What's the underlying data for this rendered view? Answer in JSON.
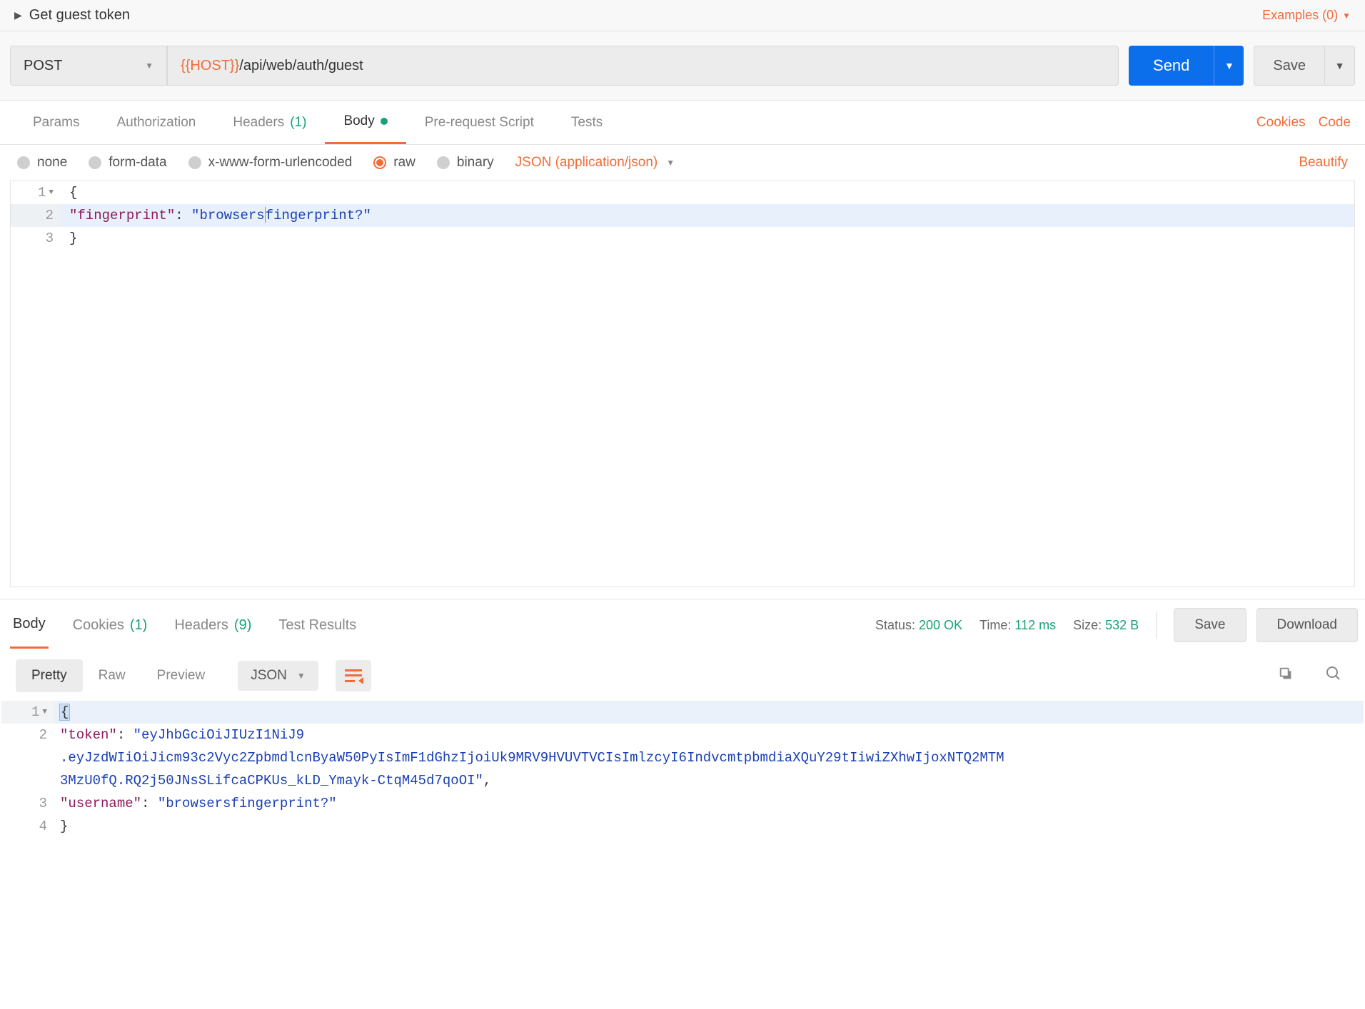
{
  "title": "Get guest token",
  "examples": {
    "label": "Examples (0)"
  },
  "request": {
    "method": "POST",
    "url_var": "{{HOST}}",
    "url_path": "/api/web/auth/guest",
    "send_label": "Send",
    "save_label": "Save"
  },
  "req_tabs": {
    "params": "Params",
    "authorization": "Authorization",
    "headers": "Headers",
    "headers_count": "(1)",
    "body": "Body",
    "prerequest": "Pre-request Script",
    "tests": "Tests",
    "cookies_link": "Cookies",
    "code_link": "Code"
  },
  "body_types": {
    "none": "none",
    "formdata": "form-data",
    "xwww": "x-www-form-urlencoded",
    "raw": "raw",
    "binary": "binary",
    "content_type": "JSON (application/json)",
    "beautify": "Beautify"
  },
  "req_body": {
    "lines": [
      "1",
      "2",
      "3"
    ],
    "l1": "{",
    "l2_key": "\"fingerprint\"",
    "l2_colon": ": ",
    "l2_val_a": "\"browsers",
    "l2_val_b": "fingerprint?\"",
    "l3": "}"
  },
  "resp_tabs": {
    "body": "Body",
    "cookies": "Cookies",
    "cookies_count": "(1)",
    "headers": "Headers",
    "headers_count": "(9)",
    "tests": "Test Results"
  },
  "resp_meta": {
    "status_label": "Status:",
    "status_value": "200 OK",
    "time_label": "Time:",
    "time_value": "112 ms",
    "size_label": "Size:",
    "size_value": "532 B",
    "save": "Save",
    "download": "Download"
  },
  "view_row": {
    "pretty": "Pretty",
    "raw": "Raw",
    "preview": "Preview",
    "format": "JSON"
  },
  "resp_body": {
    "gutters": [
      "1",
      "2",
      "",
      "",
      "3",
      "4"
    ],
    "l1": "{",
    "l2_key": "\"token\"",
    "l2_colon": ": ",
    "l2_val1": "\"eyJhbGciOiJIUzI1NiJ9",
    "l2_val2": ".eyJzdWIiOiJicm93c2Vyc2ZpbmdlcnByaW50PyIsImF1dGhzIjoiUk9MRV9HVUVTVCIsImlzcyI6IndvcmtpbmdiaXQuY29tIiwiZXhwIjoxNTQ2MTM",
    "l2_val3": "3MzU0fQ.RQ2j50JNsSLifcaCPKUs_kLD_Ymayk-CtqM45d7qoOI\"",
    "l2_comma": ",",
    "l3_key": "\"username\"",
    "l3_colon": ": ",
    "l3_val": "\"browsersfingerprint?\"",
    "l4": "}"
  }
}
